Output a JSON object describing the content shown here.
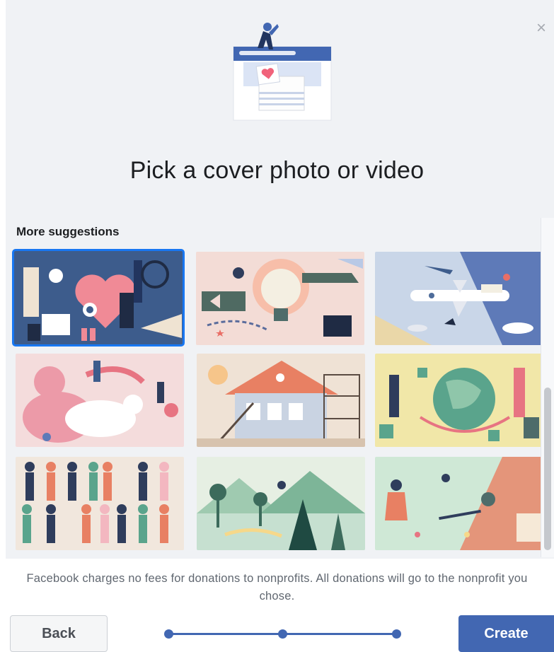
{
  "dialog": {
    "title": "Pick a cover photo or video",
    "close_icon": "close-icon"
  },
  "suggestions": {
    "heading": "More suggestions",
    "selected_index": 0
  },
  "footer": {
    "notice": "Facebook charges no fees for donations to nonprofits. All donations will go to the nonprofit you chose.",
    "back_label": "Back",
    "create_label": "Create",
    "progress_steps": 3,
    "current_step": 3
  },
  "colors": {
    "accent": "#4267b2",
    "selection": "#1877f2",
    "heart": "#f1637b"
  }
}
